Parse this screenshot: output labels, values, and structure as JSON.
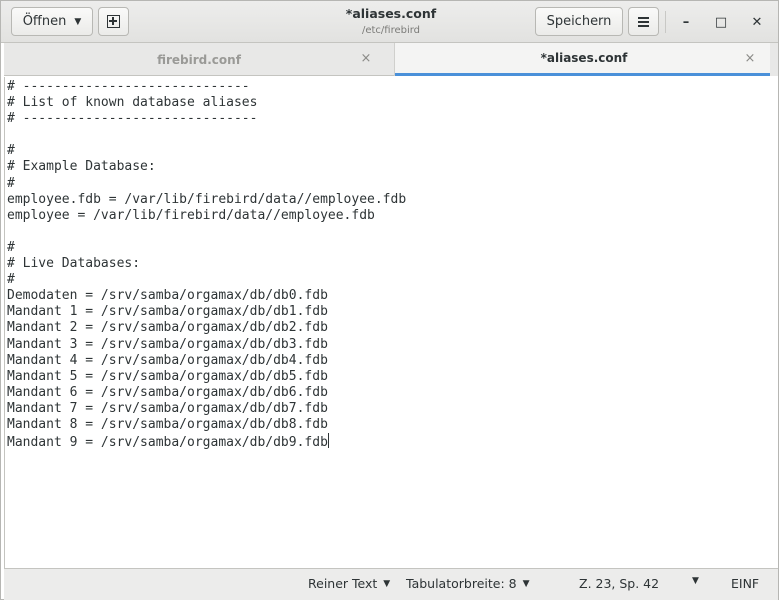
{
  "header": {
    "open_label": "Öffnen",
    "open_caret": "▼",
    "new_icon": "new-document-icon",
    "title": "*aliases.conf",
    "subtitle": "/etc/firebird",
    "save_label": "Speichern",
    "menu_icon": "hamburger-menu-icon",
    "minimize_glyph": "–",
    "maximize_glyph": "□",
    "close_glyph": "✕"
  },
  "tabs": [
    {
      "label": "firebird.conf",
      "active": false,
      "close": "×"
    },
    {
      "label": "*aliases.conf",
      "active": true,
      "close": "×"
    }
  ],
  "editor": {
    "lines": [
      "# -----------------------------",
      "# List of known database aliases",
      "# ------------------------------",
      "",
      "#",
      "# Example Database:",
      "#",
      "employee.fdb = /var/lib/firebird/data//employee.fdb",
      "employee = /var/lib/firebird/data//employee.fdb",
      "",
      "#",
      "# Live Databases:",
      "#",
      "Demodaten = /srv/samba/orgamax/db/db0.fdb",
      "Mandant 1 = /srv/samba/orgamax/db/db1.fdb",
      "Mandant 2 = /srv/samba/orgamax/db/db2.fdb",
      "Mandant 3 = /srv/samba/orgamax/db/db3.fdb",
      "Mandant 4 = /srv/samba/orgamax/db/db4.fdb",
      "Mandant 5 = /srv/samba/orgamax/db/db5.fdb",
      "Mandant 6 = /srv/samba/orgamax/db/db6.fdb",
      "Mandant 7 = /srv/samba/orgamax/db/db7.fdb",
      "Mandant 8 = /srv/samba/orgamax/db/db8.fdb",
      "Mandant 9 = /srv/samba/orgamax/db/db9.fdb"
    ],
    "cursor_line": 23
  },
  "status": {
    "language": "Reiner Text",
    "tab_width": "Tabulatorbreite: 8",
    "position": "Z. 23, Sp. 42",
    "mode": "EINF",
    "caret": "▼"
  },
  "colors": {
    "accent": "#4a90d9",
    "text": "#2e3436",
    "inactive_tab_text": "#9a9a97"
  }
}
